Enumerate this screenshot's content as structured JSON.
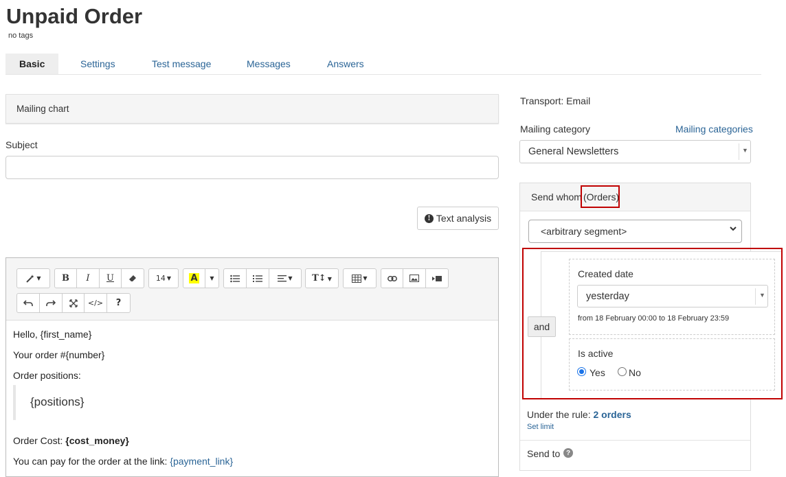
{
  "header": {
    "title": "Unpaid Order",
    "tags": "no tags"
  },
  "tabs": [
    {
      "label": "Basic",
      "active": true
    },
    {
      "label": "Settings",
      "active": false
    },
    {
      "label": "Test message",
      "active": false
    },
    {
      "label": "Messages",
      "active": false
    },
    {
      "label": "Answers",
      "active": false
    }
  ],
  "main": {
    "mailing_chart": "Mailing chart",
    "subject_label": "Subject",
    "subject_value": "",
    "text_analysis_label": "Text analysis"
  },
  "editor": {
    "toolbar": {
      "magic_icon": "magic-wand-icon",
      "bold": "B",
      "italic": "I",
      "underline": "U",
      "eraser_icon": "eraser-icon",
      "font_size": "14",
      "highlight": "A",
      "unordered_list_icon": "bullet-list-icon",
      "ordered_list_icon": "numbered-list-icon",
      "align_icon": "align-icon",
      "text_height": "T↕",
      "table_icon": "table-icon",
      "link_icon": "link-icon",
      "image_icon": "image-icon",
      "video_icon": "video-icon",
      "undo_icon": "undo-icon",
      "redo_icon": "redo-icon",
      "fullscreen_icon": "fullscreen-icon",
      "code": "</>",
      "help": "?"
    },
    "body": {
      "greeting": "Hello, {first_name}",
      "order_number": "Your order #{number}",
      "order_positions": "Order positions:",
      "positions": "{positions}",
      "cost_prefix": "Order Cost: ",
      "cost_value": "{cost_money}",
      "pay_prefix": "You can pay for the order at the link: ",
      "pay_link": "{payment_link}"
    }
  },
  "sidebar": {
    "transport": "Transport: Email",
    "mailing_category_label": "Mailing category",
    "mailing_categories_link": "Mailing categories",
    "category_value": "General Newsletters",
    "send_whom_label": "Send whom",
    "send_whom_entity": "(Orders)",
    "segment_value": "<arbitrary segment>",
    "and_label": "and",
    "created_date_label": "Created date",
    "created_date_value": "yesterday",
    "date_range": "from 18 February 00:00 to 18 February 23:59",
    "is_active_label": "Is active",
    "yes_label": "Yes",
    "no_label": "No",
    "is_active_value": "Yes",
    "rule_prefix": "Under the rule: ",
    "rule_count": "2 orders",
    "set_limit": "Set limit",
    "send_to_label": "Send to"
  },
  "colors": {
    "link": "#2a6496",
    "highlight_border": "#c00000",
    "radio_checked": "#1a73e8"
  }
}
